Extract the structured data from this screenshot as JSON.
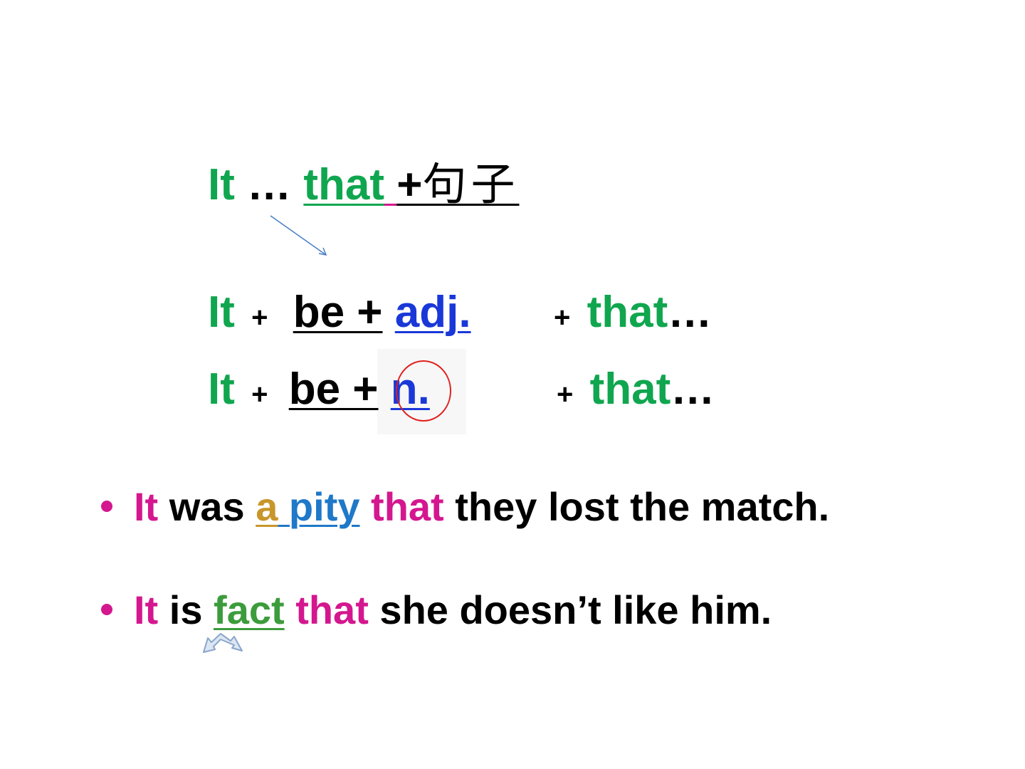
{
  "row1": {
    "it": "It",
    "ellipsis": "…",
    "that": "that",
    "space": " ",
    "plus": "+",
    "sentence": "句子"
  },
  "row2": {
    "it": "It",
    "plus1": "+",
    "be": "be +",
    "adj": "adj.",
    "plus2": "+",
    "that": "that",
    "ellipsis": "…"
  },
  "row3": {
    "it": "It",
    "plus1": "+",
    "be": "be +",
    "n": "n.",
    "plus2": "+",
    "that": "that",
    "ellipsis": "…"
  },
  "example1": {
    "it": "It",
    "was": "was",
    "a": "a",
    "pity": "pity",
    "that": "that",
    "rest": "they lost the match."
  },
  "example2": {
    "it": "It",
    "is": "is",
    "fact": "fact",
    "that": "that",
    "rest": "she doesn’t like him."
  },
  "colors": {
    "green": "#10a64f",
    "blue": "#1a38d8",
    "magenta": "#d4178f",
    "gold": "#c8962a",
    "light_blue": "#1f78c8",
    "circle_red": "#e0201f"
  },
  "icons": [
    "arrow-down-right-icon",
    "red-circle-highlight",
    "bidirectional-arrow-icon",
    "bullet-dot"
  ]
}
